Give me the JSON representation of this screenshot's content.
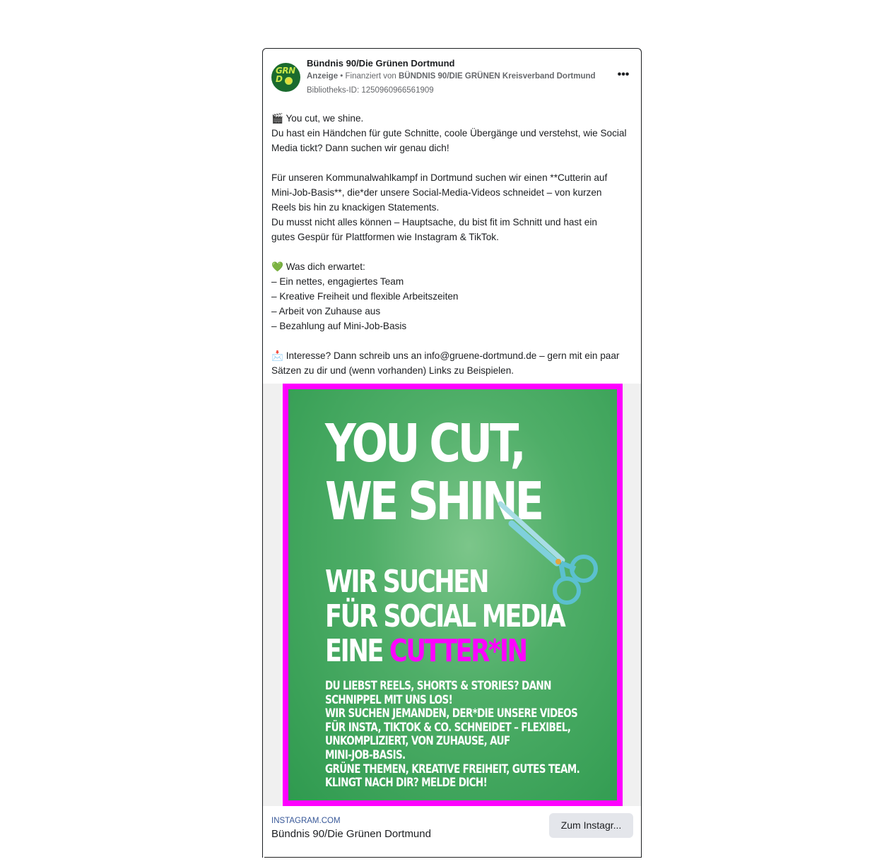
{
  "ad": {
    "page_name": "Bündnis 90/Die Grünen Dortmund",
    "avatar_text_line1": "GRN",
    "avatar_text_line2": "D",
    "sponsored_label": "Anzeige",
    "separator": " • ",
    "funded_prefix": "Finanziert von ",
    "funded_by": "BÜNDNIS 90/DIE GRÜNEN Kreisverband Dortmund",
    "library_id": "Bibliotheks-ID: 1250960966561909",
    "more_label": "•••"
  },
  "body": {
    "lines": [
      "🎬 You cut, we shine.",
      "Du hast ein Händchen für gute Schnitte, coole Übergänge und verstehst, wie Social",
      "Media tickt? Dann suchen wir genau dich!",
      "",
      "Für unseren Kommunalwahlkampf in Dortmund suchen wir einen **Cutterin auf",
      "Mini-Job-Basis**, die*der unsere Social-Media-Videos schneidet – von kurzen",
      "Reels bis hin zu knackigen Statements.",
      "Du musst nicht alles können – Hauptsache, du bist fit im Schnitt und hast ein",
      "gutes Gespür für Plattformen wie Instagram & TikTok.",
      "",
      "💚 Was dich erwartet:",
      "– Ein nettes, engagiertes Team",
      "– Kreative Freiheit und flexible Arbeitszeiten",
      "– Arbeit von Zuhause aus",
      "– Bezahlung auf Mini-Job-Basis",
      "",
      "📩 Interesse? Dann schreib uns an info@gruene-dortmund.de – gern mit ein paar",
      "Sätzen zu dir und (wenn vorhanden) Links zu Beispielen."
    ]
  },
  "creative": {
    "headline_line1": "YOU CUT,",
    "headline_line2": "WE SHINE",
    "sub_line1": "WIR SUCHEN",
    "sub_line2": "FÜR SOCIAL MEDIA",
    "sub_line3_prefix": "EINE ",
    "sub_line3_highlight": "CUTTER*IN",
    "small_lines": [
      "DU LIEBST REELS, SHORTS & STORIES? DANN",
      "SCHNIPPEL MIT UNS LOS!",
      "WIR SUCHEN JEMANDEN, DER*DIE UNSERE VIDEOS",
      "FÜR INSTA, TIKTOK & CO. SCHNEIDET – FLEXIBEL,",
      "UNKOMPLIZIERT, VON ZUHAUSE, AUF",
      "MINI-JOB-BASIS.",
      "GRÜNE THEMEN, KREATIVE FREIHEIT, GUTES TEAM.",
      "KLINGT NACH DIR? MELDE DICH!"
    ],
    "colors": {
      "frame": "#ff00ff",
      "background": "#4fae68",
      "highlight": "#ff00ff",
      "scissors": "#5bc0cf"
    },
    "icon": "scissors-icon"
  },
  "footer": {
    "domain": "INSTAGRAM.COM",
    "title": "Bündnis 90/Die Grünen Dortmund",
    "cta_label": "Zum Instagr..."
  }
}
